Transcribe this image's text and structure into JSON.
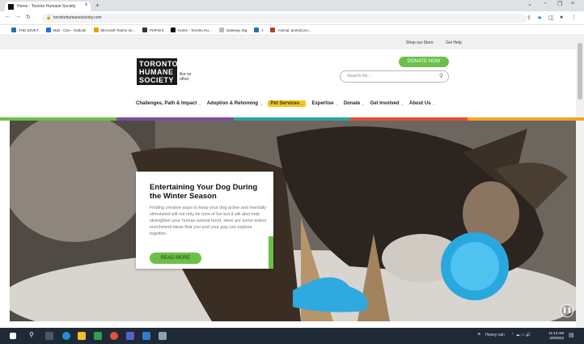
{
  "browser": {
    "tab_title": "Home - Toronto Humane Society",
    "new_tab": "+",
    "close_tab": "x",
    "url": "torontohumanesociety.com",
    "controls": {
      "minimize": "−",
      "restore": "❐",
      "close": "×"
    },
    "bookmarks": [
      {
        "label": "THE SZVET",
        "color": "#2b6cb0"
      },
      {
        "label": "Mail - CSA - Outlook",
        "color": "#1a73e8"
      },
      {
        "label": "Microsoft Teams us...",
        "color": "#e8a200"
      },
      {
        "label": "PetPoint",
        "color": "#333333"
      },
      {
        "label": "Home - Toronto Hu...",
        "color": "#111111"
      },
      {
        "label": "Gateway Sig",
        "color": "#bbbbbb"
      },
      {
        "label": "s",
        "color": "#2b6cb0"
      },
      {
        "label": "Animal, animal pro...",
        "color": "#c0392b"
      }
    ]
  },
  "site": {
    "top_links": {
      "shop": "Shop our Store",
      "help": "Get Help"
    },
    "logo": {
      "line1": "TORONTO",
      "line2": "HUMANE",
      "line3": "SOCIETY",
      "tagline": "like no other."
    },
    "donate_label": "DONATE NOW",
    "search_placeholder": "Search for...",
    "nav": [
      {
        "label": "Challenges, Path & Impact",
        "active": false
      },
      {
        "label": "Adoption & Rehoming",
        "active": false
      },
      {
        "label": "Pet Services",
        "active": true
      },
      {
        "label": "Expertise",
        "active": false
      },
      {
        "label": "Donate",
        "active": false
      },
      {
        "label": "Get Involved",
        "active": false
      },
      {
        "label": "About Us",
        "active": false
      }
    ],
    "stripe_colors": [
      "#6cc04a",
      "#7b4fa0",
      "#2aa7a0",
      "#e84d3d",
      "#f5a623"
    ],
    "hero": {
      "title": "Entertaining Your Dog During the Winter Season",
      "body": "Finding creative ways to keep your dog active and mentally stimulated will not only be tons of fun but it will also help strengthen your human-animal bond. Here are some indoor enrichment ideas that you and your pup can explore together.",
      "read_more": "READ MORE"
    }
  },
  "taskbar": {
    "weather": "Heavy rain",
    "time": "11:14 AM",
    "date": "2/9/2023"
  }
}
